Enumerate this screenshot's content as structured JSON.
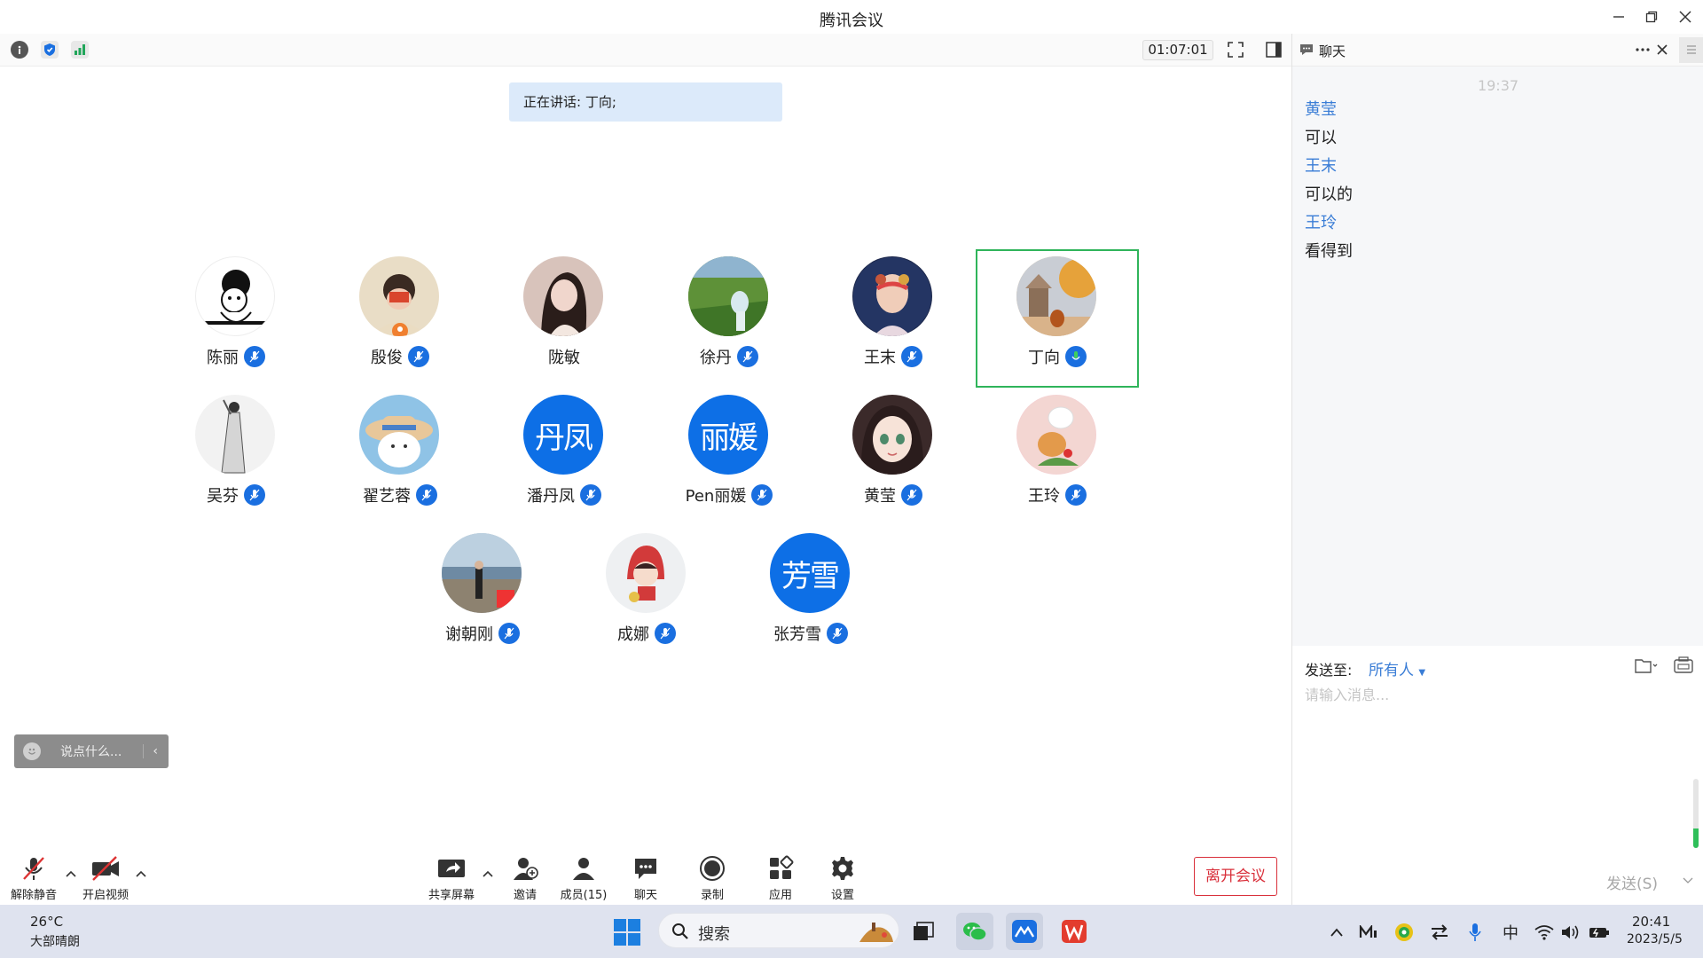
{
  "window": {
    "title": "腾讯会议",
    "timer": "01:07:01"
  },
  "stage": {
    "speaking": "正在讲话: 丁向;",
    "say_placeholder": "说点什么..."
  },
  "participants": [
    {
      "name": "陈丽",
      "avatar": "photo"
    },
    {
      "name": "殷俊",
      "avatar": "photo"
    },
    {
      "name": "陇敏",
      "avatar": "photo"
    },
    {
      "name": "徐丹",
      "avatar": "photo"
    },
    {
      "name": "王末",
      "avatar": "photo"
    },
    {
      "name": "丁向",
      "avatar": "photo"
    },
    {
      "name": "吴芬",
      "avatar": "photo"
    },
    {
      "name": "翟艺蓉",
      "avatar": "photo"
    },
    {
      "name": "潘丹凤",
      "avatar_text": "丹凤"
    },
    {
      "name": "Pen丽媛",
      "avatar_text": "丽媛"
    },
    {
      "name": "黄莹",
      "avatar": "photo"
    },
    {
      "name": "王玲",
      "avatar": "photo"
    },
    {
      "name": "谢朝刚",
      "avatar": "photo"
    },
    {
      "name": "成娜",
      "avatar": "photo"
    },
    {
      "name": "张芳雪",
      "avatar_text": "芳雪"
    }
  ],
  "controls": {
    "unmute": "解除静音",
    "start_video": "开启视频",
    "share_screen": "共享屏幕",
    "invite": "邀请",
    "members": "成员(15)",
    "chat": "聊天",
    "record": "录制",
    "apps": "应用",
    "settings": "设置",
    "leave": "离开会议"
  },
  "chat": {
    "title": "聊天",
    "time": "19:37",
    "messages": [
      {
        "sender": "黄莹",
        "text": "可以"
      },
      {
        "sender": "王末",
        "text": "可以的"
      },
      {
        "sender": "王玲",
        "text": "看得到"
      }
    ],
    "send_to_label": "发送至:",
    "send_to_value": "所有人",
    "input_placeholder": "请输入消息...",
    "send_button": "发送(S)"
  },
  "taskbar": {
    "temperature": "26°C",
    "weather": "大部晴朗",
    "search": "搜索",
    "ime": "中",
    "time": "20:41",
    "date": "2023/5/5"
  },
  "colors": {
    "accent": "#1a6fe0",
    "speaker_border": "#2fb45a",
    "leave": "#d9303b",
    "chat_sender": "#3a7dd6"
  }
}
